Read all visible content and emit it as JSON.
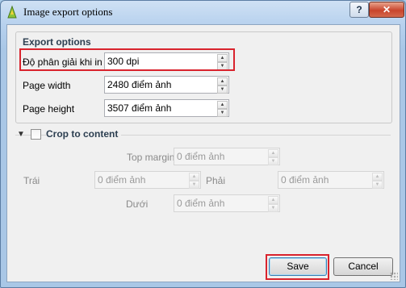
{
  "window": {
    "title": "Image export options",
    "help_label": "?",
    "close_label": "✕"
  },
  "export_options": {
    "title": "Export options",
    "resolution": {
      "label": "Độ phân giải khi in",
      "value": "300 dpi"
    },
    "page_width": {
      "label": "Page width",
      "value": "2480 điểm ảnh"
    },
    "page_height": {
      "label": "Page height",
      "value": "3507 điểm ảnh"
    }
  },
  "crop": {
    "label": "Crop to content",
    "checked": false,
    "top_margin": {
      "label": "Top margin",
      "value": "0 điểm ảnh"
    },
    "left": {
      "label": "Trái",
      "value": "0 điểm ảnh"
    },
    "right": {
      "label": "Phải",
      "value": "0 điểm ảnh"
    },
    "bottom": {
      "label": "Dưới",
      "value": "0 điểm ảnh"
    }
  },
  "buttons": {
    "save": "Save",
    "cancel": "Cancel"
  },
  "colors": {
    "highlight": "#d9232d",
    "titlebar": "#b7d1ee",
    "dialog_bg": "#f0f0f0"
  }
}
